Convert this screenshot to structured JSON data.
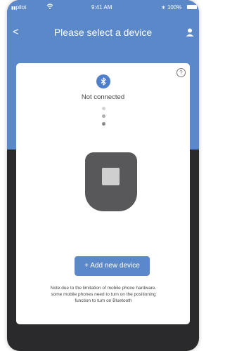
{
  "status_bar": {
    "carrier": "pilot",
    "time": "9:41 AM",
    "battery": "100%"
  },
  "nav": {
    "back_symbol": "<",
    "title": "Please select a device",
    "user_icon": "user-icon"
  },
  "card": {
    "help_symbol": "?",
    "bluetooth_icon": "bluetooth-icon",
    "connection_status": "Not connected",
    "add_device_label": "+ Add new device",
    "note_lines": [
      "Note:due to the limitation of mobile phone hardware.",
      "some mobile phones need to turn on the positioning",
      "function to turn on Bluetooth"
    ]
  },
  "colors": {
    "brand_blue": "#5b88c9",
    "dark_background": "#2a2a2c",
    "device_gray": "#58575a"
  }
}
